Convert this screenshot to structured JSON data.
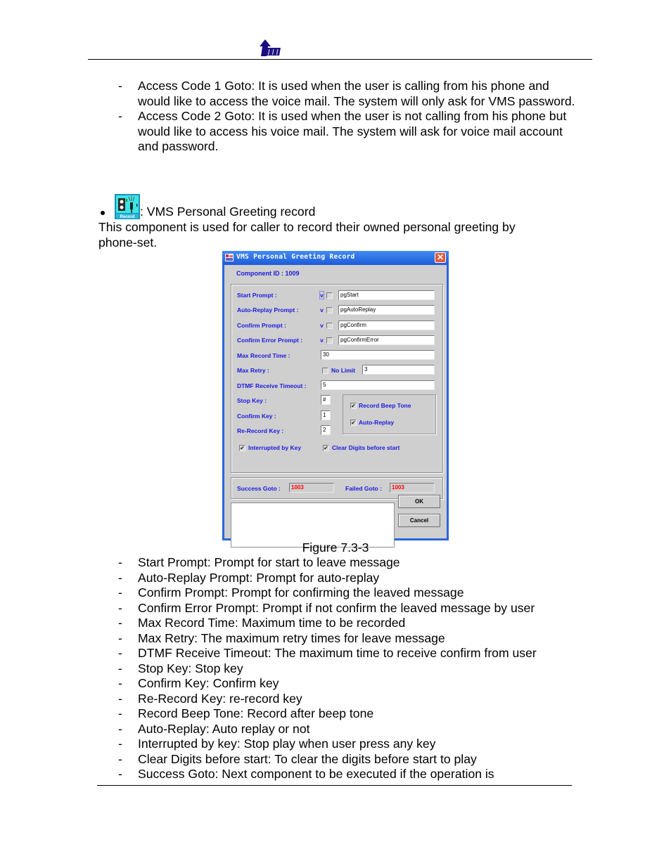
{
  "header": {
    "logo_icon": "company-logo-arrow-icon"
  },
  "intro_items": [
    {
      "dash": "-",
      "text": "Access Code 1 Goto: It is used when the user is calling from his phone and would like to access the voice mail. The system will only ask for VMS password."
    },
    {
      "dash": "-",
      "text": "Access Code 2 Goto: It is used when the user is not calling from his phone but would like to access his voice mail. The system will ask for voice mail account and password."
    }
  ],
  "component": {
    "icon": "record-component-icon",
    "icon_label": "Record",
    "bullet_text": ": VMS Personal Greeting record",
    "description": "This component is used for caller to record their owned personal greeting by phone-set."
  },
  "dialog": {
    "title": "VMS Personal Greeting Record",
    "close_symbol": "✕",
    "component_id_label": "Component ID : 1009",
    "fields": {
      "start_prompt": {
        "label": "Start Prompt :",
        "v": "v",
        "value": "pgStart"
      },
      "auto_replay_prompt": {
        "label": "Auto-Replay Prompt :",
        "v": "v",
        "value": "pgAutoReplay"
      },
      "confirm_prompt": {
        "label": "Confirm Prompt :",
        "v": "v",
        "value": "pgConfirm"
      },
      "confirm_error_prompt": {
        "label": "Confirm Error Prompt :",
        "v": "v",
        "value": "pgConfirmError"
      },
      "max_record_time": {
        "label": "Max Record Time :",
        "value": "30"
      },
      "max_retry": {
        "label": "Max Retry :",
        "no_limit_label": "No Limit",
        "no_limit_checked": false,
        "value": "3"
      },
      "dtmf_timeout": {
        "label": "DTMF Receive Timeout :",
        "value": "5"
      },
      "stop_key": {
        "label": "Stop Key :",
        "value": "#"
      },
      "confirm_key": {
        "label": "Confirm Key :",
        "value": "1"
      },
      "rerecord_key": {
        "label": "Re-Record Key :",
        "value": "2"
      }
    },
    "options": {
      "record_beep_tone": {
        "label": "Record Beep Tone",
        "checked": true
      },
      "auto_replay": {
        "label": "Auto-Replay",
        "checked": true
      },
      "interrupted_by_key": {
        "label": "Interrupted by Key",
        "checked": true
      },
      "clear_digits": {
        "label": "Clear Digits before start",
        "checked": true
      }
    },
    "check_mark": "✔",
    "goto": {
      "success_label": "Success Goto :",
      "success_value": "1003",
      "failed_label": "Failed Goto :",
      "failed_value": "1003"
    },
    "buttons": {
      "ok": "OK",
      "cancel": "Cancel"
    }
  },
  "figure_caption": "Figure 7.3-3",
  "param_items": [
    {
      "dash": "-",
      "text": "Start Prompt: Prompt for start to leave message"
    },
    {
      "dash": "-",
      "text": "Auto-Replay Prompt: Prompt for auto-replay"
    },
    {
      "dash": "-",
      "text": "Confirm Prompt: Prompt for confirming the leaved message"
    },
    {
      "dash": "-",
      "text": "Confirm Error Prompt: Prompt if not confirm the leaved message by user"
    },
    {
      "dash": "-",
      "text": "Max Record Time: Maximum time to be recorded"
    },
    {
      "dash": "-",
      "text": "Max Retry: The maximum retry times for leave message"
    },
    {
      "dash": "-",
      "text": "DTMF Receive Timeout: The maximum time to receive confirm from user"
    },
    {
      "dash": "-",
      "text": "Stop Key: Stop key"
    },
    {
      "dash": "-",
      "text": "Confirm Key: Confirm key"
    },
    {
      "dash": "-",
      "text": "Re-Record Key: re-record key"
    },
    {
      "dash": "-",
      "text": "Record Beep Tone: Record after beep tone"
    },
    {
      "dash": "-",
      "text": "Auto-Replay: Auto replay or not"
    },
    {
      "dash": "-",
      "text": "Interrupted by key: Stop play when user press any key"
    },
    {
      "dash": "-",
      "text": "Clear Digits before start: To clear the digits before start to play"
    },
    {
      "dash": "-",
      "text": "Success Goto: Next component to be executed if the operation is"
    }
  ]
}
